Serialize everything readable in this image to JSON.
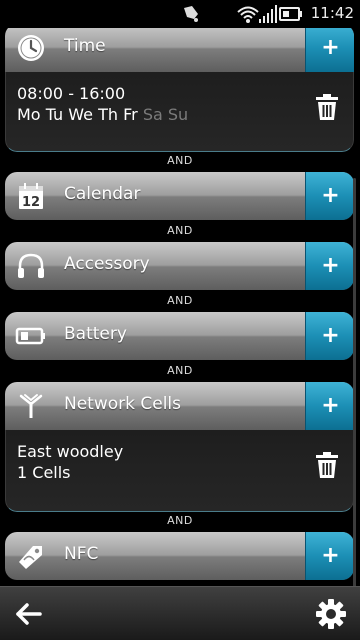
{
  "status_bar": {
    "time": "11:42",
    "icons": [
      "notification-icon",
      "wifi-icon",
      "signal-icon",
      "battery-icon"
    ]
  },
  "conditions": [
    {
      "id": "time",
      "title": "Time",
      "icon": "clock-icon",
      "add_label": "+",
      "body": {
        "line1": "08:00 - 16:00",
        "days": [
          {
            "label": "Mo",
            "active": true
          },
          {
            "label": "Tu",
            "active": true
          },
          {
            "label": "We",
            "active": true
          },
          {
            "label": "Th",
            "active": true
          },
          {
            "label": "Fr",
            "active": true
          },
          {
            "label": "Sa",
            "active": false
          },
          {
            "label": "Su",
            "active": false
          }
        ],
        "delete_icon": "trash-icon"
      }
    },
    {
      "id": "calendar",
      "title": "Calendar",
      "icon": "calendar-icon",
      "icon_text": "12",
      "add_label": "+"
    },
    {
      "id": "accessory",
      "title": "Accessory",
      "icon": "headphones-icon",
      "add_label": "+"
    },
    {
      "id": "battery",
      "title": "Battery",
      "icon": "battery-icon",
      "add_label": "+"
    },
    {
      "id": "network",
      "title": "Network Cells",
      "icon": "antenna-icon",
      "add_label": "+",
      "body": {
        "line1": "East woodley",
        "line2": "1 Cells",
        "delete_icon": "trash-icon"
      }
    },
    {
      "id": "nfc",
      "title": "NFC",
      "icon": "nfc-tag-icon",
      "add_label": "+"
    }
  ],
  "connector_label": "AND",
  "toolbar": {
    "back_icon": "back-arrow-icon",
    "settings_icon": "gear-icon"
  },
  "colors": {
    "accent": "#1c8fb5",
    "header_gray": "#9e9e9e",
    "inactive_day": "#7b7b7b"
  }
}
